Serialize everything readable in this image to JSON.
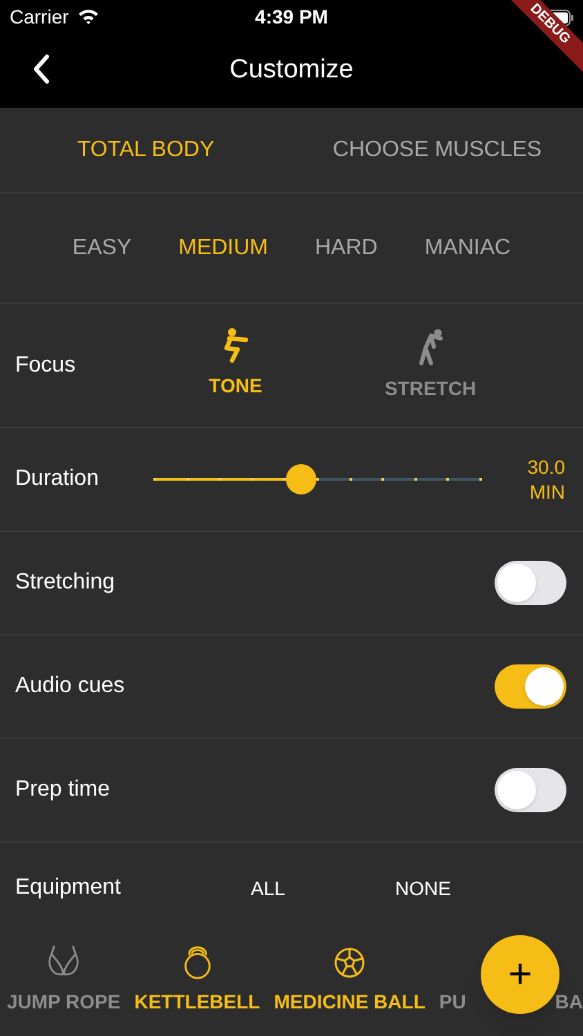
{
  "status_bar": {
    "carrier": "Carrier",
    "time": "4:39 PM"
  },
  "debug_banner": "DEBUG",
  "nav": {
    "title": "Customize"
  },
  "mode_tabs": [
    {
      "label": "TOTAL BODY",
      "selected": true
    },
    {
      "label": "CHOOSE MUSCLES",
      "selected": false
    }
  ],
  "difficulty": [
    {
      "label": "EASY",
      "selected": false
    },
    {
      "label": "MEDIUM",
      "selected": true
    },
    {
      "label": "HARD",
      "selected": false
    },
    {
      "label": "MANIAC",
      "selected": false
    }
  ],
  "focus": {
    "label": "Focus",
    "options": [
      {
        "label": "TONE",
        "kind": "tone",
        "selected": true
      },
      {
        "label": "STRETCH",
        "kind": "stretch",
        "selected": false
      }
    ]
  },
  "duration": {
    "label": "Duration",
    "level": 0.455,
    "reading_value": "30.0",
    "reading_unit": "MIN"
  },
  "toggles": [
    {
      "label": "Stretching",
      "on": false
    },
    {
      "label": "Audio cues",
      "on": true
    },
    {
      "label": "Prep time",
      "on": false
    }
  ],
  "equipment": {
    "label": "Equipment",
    "all": "ALL",
    "none": "NONE",
    "items": [
      {
        "label": "JUMP ROPE",
        "kind": "rope",
        "selected": false
      },
      {
        "label": "KETTLEBELL",
        "kind": "kettlebell",
        "selected": true
      },
      {
        "label": "MEDICINE BALL",
        "kind": "ball",
        "selected": true
      },
      {
        "label": "PU",
        "label_end": "BA",
        "kind": "covered",
        "selected": false
      }
    ]
  },
  "fab": "+"
}
